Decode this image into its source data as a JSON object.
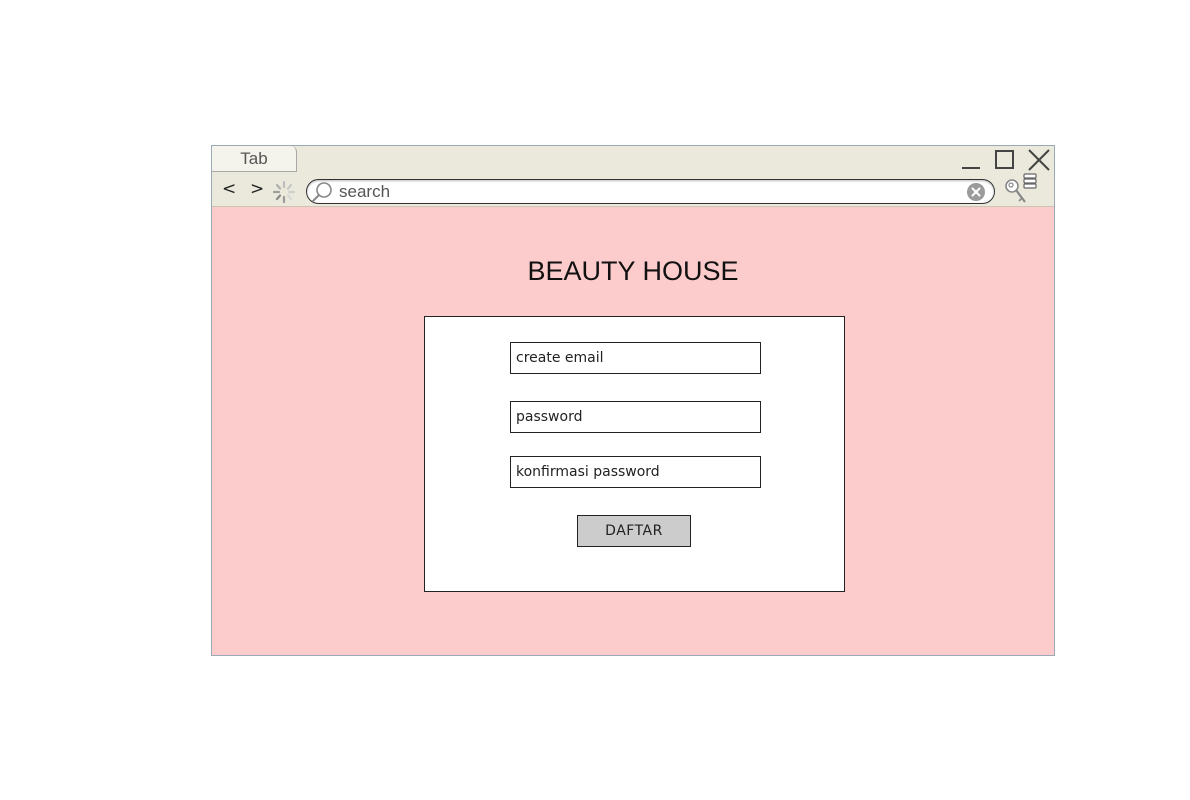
{
  "browser": {
    "tab_label": "Tab",
    "back_label": "<",
    "forward_label": ">",
    "search": {
      "placeholder": "search",
      "value": ""
    }
  },
  "page": {
    "title": "BEAUTY HOUSE",
    "form": {
      "email_placeholder": "create email",
      "password_placeholder": "password",
      "confirm_placeholder": "konfirmasi password",
      "submit_label": "DAFTAR"
    }
  },
  "colors": {
    "page_background": "#fccccc",
    "chrome_background": "#ebe9dc",
    "button_background": "#cccccc"
  }
}
